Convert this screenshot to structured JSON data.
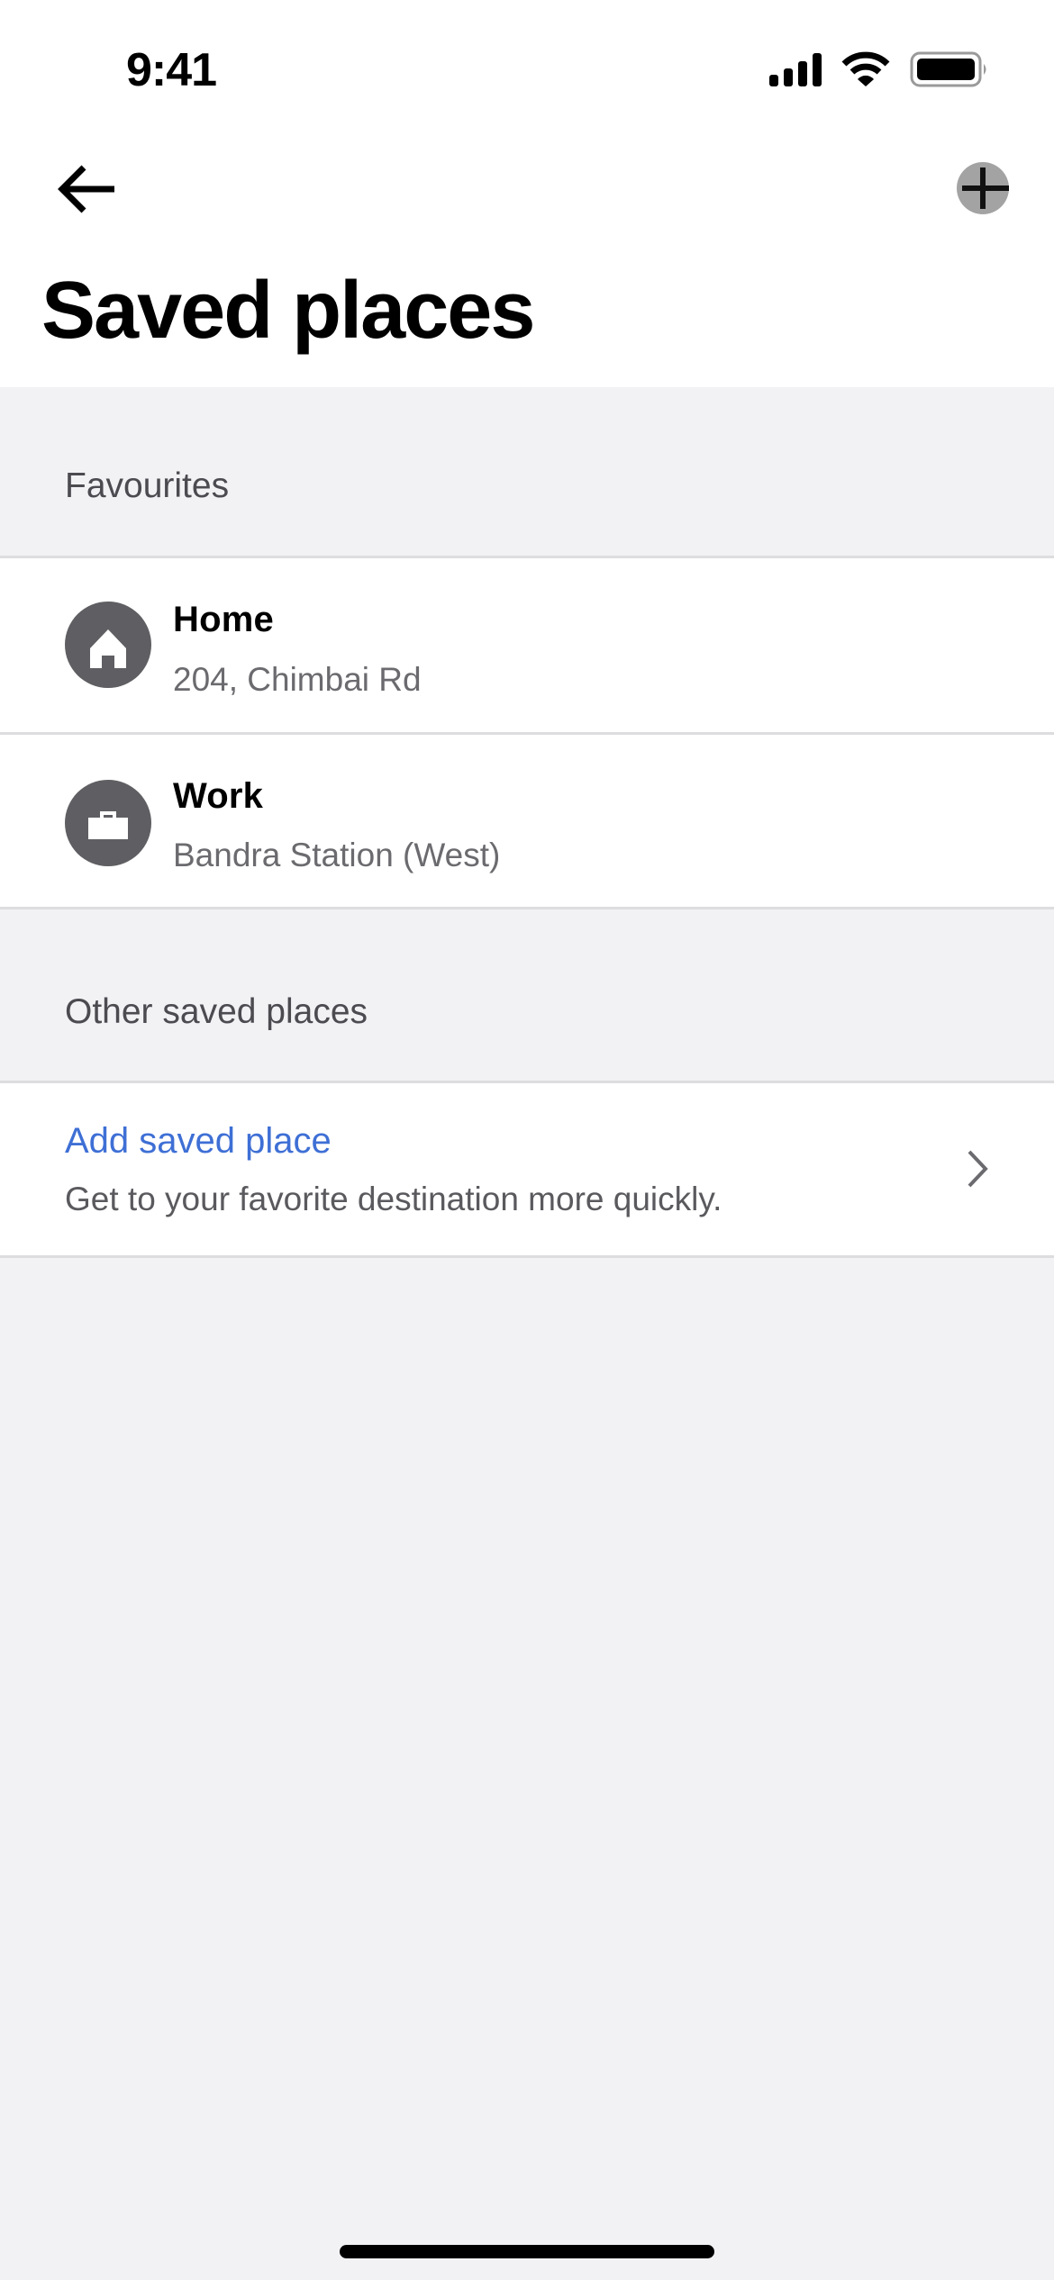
{
  "status_bar": {
    "time": "9:41",
    "icons": [
      "cellular-signal-icon",
      "wifi-icon",
      "battery-icon"
    ]
  },
  "nav": {
    "back_icon": "arrow-left-icon",
    "add_icon": "plus-icon"
  },
  "page": {
    "title": "Saved places"
  },
  "favourites": {
    "header": "Favourites",
    "items": [
      {
        "icon": "home-icon",
        "title": "Home",
        "subtitle": "204, Chimbai Rd"
      },
      {
        "icon": "briefcase-icon",
        "title": "Work",
        "subtitle": "Bandra Station (West)"
      }
    ]
  },
  "other": {
    "header": "Other saved places",
    "add_title": "Add saved place",
    "add_subtitle": "Get to your favorite destination more quickly.",
    "chevron_icon": "chevron-right-icon"
  },
  "colors": {
    "accent_link": "#3e6fd5",
    "background": "#f2f1f4",
    "icon_circle": "#5f5e62"
  }
}
